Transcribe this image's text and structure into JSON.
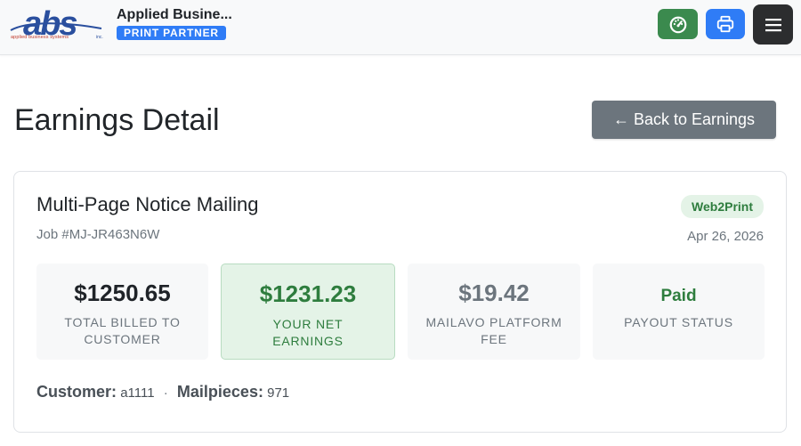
{
  "header": {
    "logo": {
      "letters": "abs",
      "tagline": "applied business systems",
      "suffix": "inc."
    },
    "brand_name": "Applied Busine...",
    "brand_badge": "PRINT PARTNER",
    "buttons": [
      {
        "icon": "dashboard-gauge-icon",
        "color": "#3b8a4e"
      },
      {
        "icon": "printer-icon",
        "color": "#2f7cf6"
      },
      {
        "icon": "hamburger-menu-icon",
        "color": "#2c2d2f"
      }
    ]
  },
  "page": {
    "title": "Earnings Detail",
    "back_button": "← Back to Earnings"
  },
  "job": {
    "title": "Multi-Page Notice Mailing",
    "id_text": "Job #MJ-JR463N6W",
    "type_badge": "Web2Print",
    "date": "Apr 26, 2026"
  },
  "stats": [
    {
      "value": "$1250.65",
      "label": "TOTAL BILLED TO CUSTOMER"
    },
    {
      "value": "$1231.23",
      "label": "YOUR NET EARNINGS"
    },
    {
      "value": "$19.42",
      "label": "MAILAVO PLATFORM FEE"
    },
    {
      "value": "Paid",
      "label": "PAYOUT STATUS"
    }
  ],
  "meta": {
    "customer_label": "Customer:",
    "customer_value": "a1111",
    "separator": "·",
    "mailpieces_label": "Mailpieces:",
    "mailpieces_value": "971"
  },
  "colors": {
    "success": "#2e7d3e",
    "primary": "#2f7cf6",
    "secondary": "#6c757d",
    "logo_blue": "#2a4f9e",
    "logo_red": "#c0392b"
  }
}
